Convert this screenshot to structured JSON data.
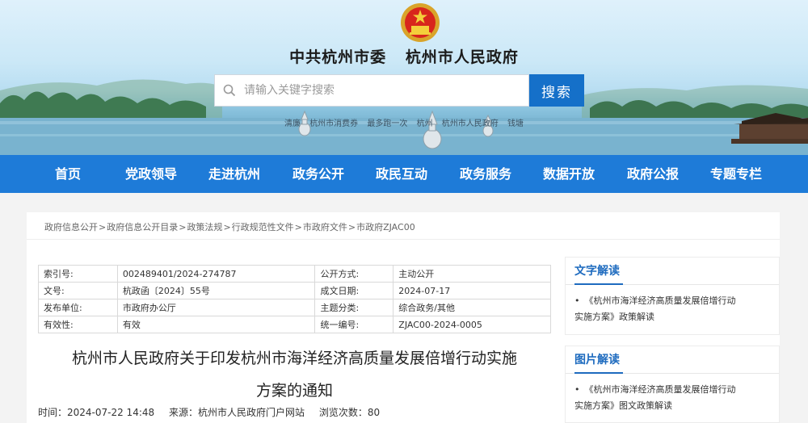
{
  "header": {
    "title_party": "中共杭州市委",
    "title_gov": "杭州市人民政府",
    "search_placeholder": "请输入关键字搜索",
    "search_button": "搜索",
    "hot_words": [
      "清廉",
      "杭州市消费券",
      "最多跑一次",
      "杭州",
      "杭州市人民政府",
      "钱塘"
    ]
  },
  "nav": {
    "items": [
      "首页",
      "党政领导",
      "走进杭州",
      "政务公开",
      "政民互动",
      "政务服务",
      "数据开放",
      "政府公报",
      "专题专栏"
    ]
  },
  "breadcrumb": [
    "政府信息公开",
    "政府信息公开目录",
    "政策法规",
    "行政规范性文件",
    "市政府文件",
    "市政府ZJAC00"
  ],
  "meta": {
    "rows": [
      {
        "k1": "索引号:",
        "v1": "002489401/2024-274787",
        "k2": "公开方式:",
        "v2": "主动公开"
      },
      {
        "k1": "文号:",
        "v1": "杭政函〔2024〕55号",
        "k2": "成文日期:",
        "v2": "2024-07-17"
      },
      {
        "k1": "发布单位:",
        "v1": "市政府办公厅",
        "k2": "主题分类:",
        "v2": "综合政务/其他"
      },
      {
        "k1": "有效性:",
        "v1": "有效",
        "k2": "统一编号:",
        "v2": "ZJAC00-2024-0005"
      }
    ]
  },
  "document": {
    "title_line1": "杭州市人民政府关于印发杭州市海洋经济高质量发展倍增行动实施",
    "title_line2": "方案的通知",
    "time": "时间：2024-07-22 14:48",
    "source": "来源：杭州市人民政府门户网站",
    "views": "浏览次数：80"
  },
  "sidebar": {
    "text_reading": {
      "title": "文字解读",
      "bullet": "•",
      "line1": "《杭州市海洋经济高质量发展倍增行动",
      "line2": "实施方案》政策解读"
    },
    "image_reading": {
      "title": "图片解读",
      "bullet": "•",
      "line1": "《杭州市海洋经济高质量发展倍增行动",
      "line2": "实施方案》图文政策解读"
    }
  },
  "colors": {
    "nav_bg": "#1e7bd8",
    "search_button": "#1570c9",
    "sidebar_heading": "#1e6bbf"
  },
  "icons": {
    "emblem": "national-emblem-icon",
    "search": "search-icon"
  }
}
